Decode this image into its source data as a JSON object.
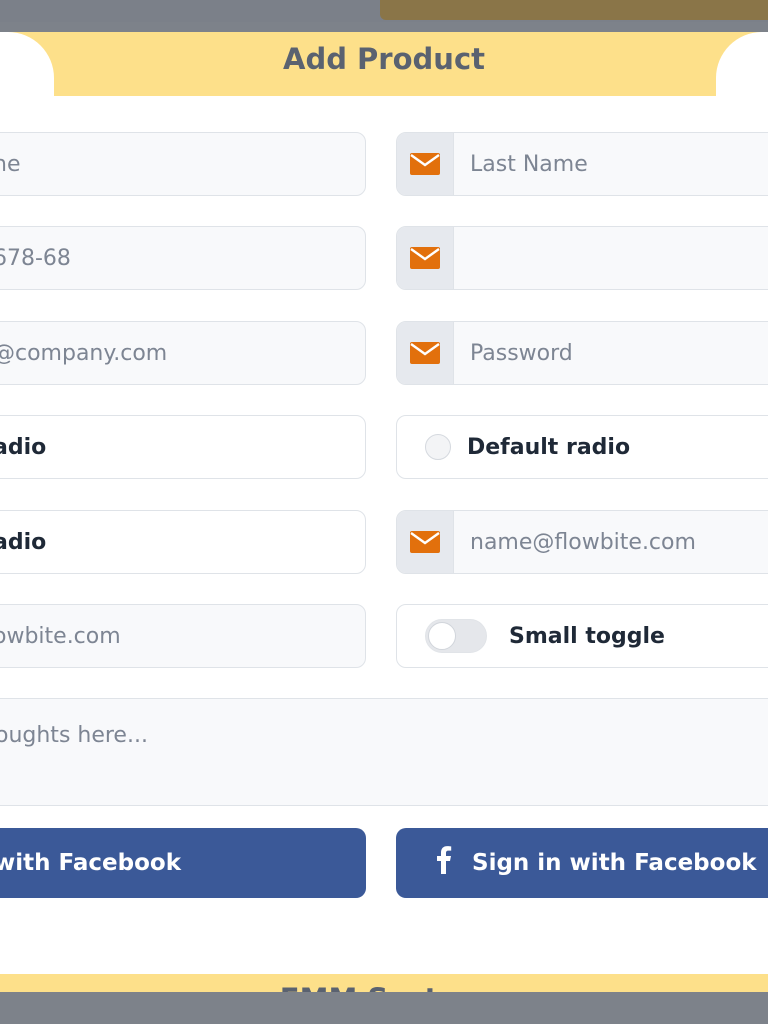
{
  "header": {
    "title": "Add Product"
  },
  "form": {
    "left": {
      "first_name_placeholder": "ne",
      "phone_placeholder": "678-68",
      "email_placeholder": "@company.com",
      "radio_1_label": "adio",
      "radio_2_label": "adio",
      "email2_placeholder": "owbite.com"
    },
    "right": {
      "last_name_placeholder": "Last Name",
      "phone_value": "",
      "password_placeholder": "Password",
      "radio_label": "Default radio",
      "email_placeholder": "name@flowbite.com",
      "toggle_label": "Small toggle"
    },
    "message_placeholder": "oughts here...",
    "left_button_label": "with Facebook",
    "right_button_label": "Sign in with Facebook"
  },
  "footer": {
    "title": "EMM System"
  },
  "icons": {
    "field_addon": "envelope-icon",
    "facebook": "facebook-icon"
  },
  "colors": {
    "header_bg": "#fde08a",
    "accent_icon": "#e2700c",
    "facebook_button": "#3b5998"
  },
  "toggle_state": false,
  "radio_state": false
}
